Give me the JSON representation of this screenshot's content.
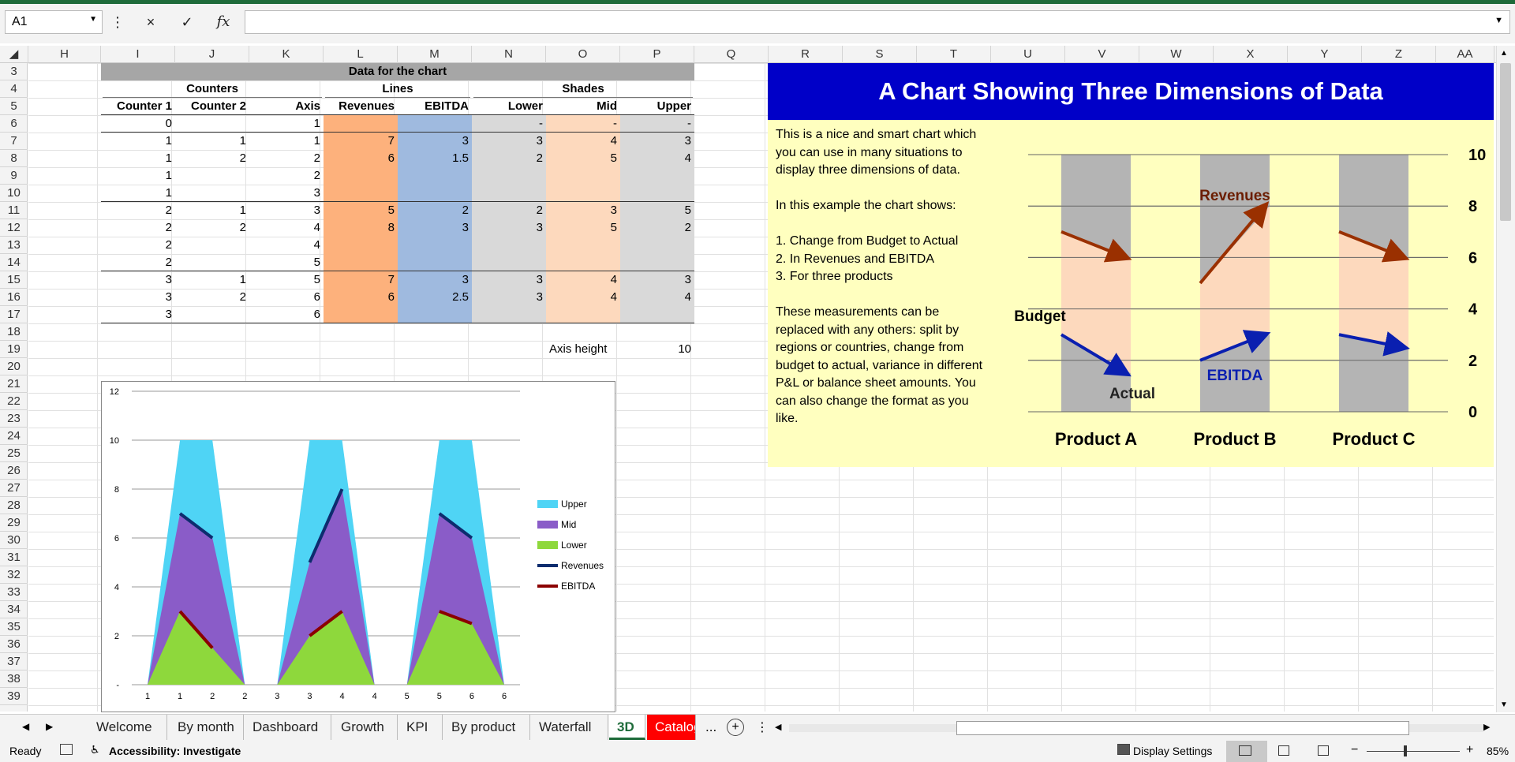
{
  "formula_bar": {
    "name_box": "A1",
    "cancel_icon": "×",
    "enter_icon": "✓",
    "fx_label": "fx",
    "formula": ""
  },
  "columns": [
    "H",
    "I",
    "J",
    "K",
    "L",
    "M",
    "N",
    "O",
    "P",
    "Q",
    "R",
    "S",
    "T",
    "U",
    "V",
    "W",
    "X",
    "Y",
    "Z",
    "AA"
  ],
  "rows": [
    "3",
    "4",
    "5",
    "6",
    "7",
    "8",
    "9",
    "10",
    "11",
    "12",
    "13",
    "14",
    "15",
    "16",
    "17",
    "18",
    "19",
    "20",
    "21",
    "22",
    "23",
    "24",
    "25",
    "26",
    "27",
    "28",
    "29",
    "30",
    "31",
    "32",
    "33",
    "34",
    "35",
    "36",
    "37",
    "38",
    "39"
  ],
  "table": {
    "title": "Data for the chart",
    "group_counters": "Counters",
    "group_lines": "Lines",
    "group_shades": "Shades",
    "headers": [
      "Counter 1",
      "Counter 2",
      "Axis",
      "Revenues",
      "EBITDA",
      "Lower",
      "Mid",
      "Upper"
    ],
    "rows": [
      [
        "0",
        "",
        "1",
        "",
        "",
        "-",
        "-",
        "-"
      ],
      [
        "1",
        "1",
        "1",
        "7",
        "3",
        "3",
        "4",
        "3"
      ],
      [
        "1",
        "2",
        "2",
        "6",
        "1.5",
        "2",
        "5",
        "4"
      ],
      [
        "1",
        "",
        "2",
        "",
        "",
        "",
        "",
        ""
      ],
      [
        "1",
        "",
        "3",
        "",
        "",
        "",
        "",
        ""
      ],
      [
        "2",
        "1",
        "3",
        "5",
        "2",
        "2",
        "3",
        "5"
      ],
      [
        "2",
        "2",
        "4",
        "8",
        "3",
        "3",
        "5",
        "2"
      ],
      [
        "2",
        "",
        "4",
        "",
        "",
        "",
        "",
        ""
      ],
      [
        "2",
        "",
        "5",
        "",
        "",
        "",
        "",
        ""
      ],
      [
        "3",
        "1",
        "5",
        "7",
        "3",
        "3",
        "4",
        "3"
      ],
      [
        "3",
        "2",
        "6",
        "6",
        "2.5",
        "3",
        "4",
        "4"
      ],
      [
        "3",
        "",
        "6",
        "",
        "",
        "",
        "",
        ""
      ]
    ],
    "axis_height_label": "Axis height",
    "axis_height_value": "10"
  },
  "info_panel": {
    "title": "A Chart Showing Three Dimensions of Data",
    "paragraph1": "This is a nice and smart chart which you can use in many situations to display three dimensions of data.",
    "paragraph2": "In this example the chart shows:",
    "list1": "1. Change from Budget to Actual",
    "list2": "2. In Revenues and EBITDA",
    "list3": "3. For three products",
    "paragraph3": "These measurements can be replaced with any others: split by regions or countries, change from budget to actual, variance in different P&L or balance sheet amounts. You can also change the format as you like.",
    "label_revenues": "Revenues",
    "label_budget": "Budget",
    "label_actual": "Actual",
    "label_ebitda": "EBITDA"
  },
  "chart_data": [
    {
      "type": "line",
      "title": "",
      "categories": [
        "Product A",
        "Product B",
        "Product C"
      ],
      "ylim": [
        0,
        10
      ],
      "y_ticks": [
        "0",
        "2",
        "4",
        "6",
        "8",
        "10"
      ],
      "series": [
        {
          "name": "Revenues",
          "budget": [
            7,
            5,
            7
          ],
          "actual": [
            6,
            8,
            6
          ]
        },
        {
          "name": "EBITDA",
          "budget": [
            3,
            2,
            3
          ],
          "actual": [
            1.5,
            3,
            2.5
          ]
        }
      ],
      "colors": {
        "revenues": "#9a3000",
        "ebitda": "#0a1fb0",
        "band_grey": "#b4b4b4",
        "band_peach": "#fdd9bd"
      }
    },
    {
      "type": "area",
      "x_ticks": [
        "1",
        "1",
        "2",
        "2",
        "3",
        "3",
        "4",
        "4",
        "5",
        "5",
        "6",
        "6"
      ],
      "y_ticks": [
        "-",
        "2",
        "4",
        "6",
        "8",
        "10",
        "12"
      ],
      "ylim": [
        0,
        12
      ],
      "legend": [
        "Upper",
        "Mid",
        "Lower",
        "Revenues",
        "EBITDA"
      ],
      "legend_position": "right",
      "axis_height": 10,
      "groups": [
        {
          "revenues": [
            7,
            6
          ],
          "ebitda": [
            3,
            1.5
          ]
        },
        {
          "revenues": [
            5,
            8
          ],
          "ebitda": [
            2,
            3
          ]
        },
        {
          "revenues": [
            7,
            6
          ],
          "ebitda": [
            3,
            2.5
          ]
        }
      ],
      "colors": {
        "upper": "#4fd4f5",
        "mid": "#8a5cc8",
        "lower": "#8ed83c",
        "revenues": "#0d2c6e",
        "ebitda": "#8b0000"
      }
    }
  ],
  "sheet_tabs": [
    "Welcome",
    "By month",
    "Dashboard",
    "Growth",
    "KPI",
    "By product",
    "Waterfall",
    "3D",
    "Catalog"
  ],
  "sheet_tabs_more": "...",
  "status": {
    "ready": "Ready",
    "accessibility": "Accessibility: Investigate",
    "display_settings": "Display Settings",
    "zoom": "85%"
  }
}
